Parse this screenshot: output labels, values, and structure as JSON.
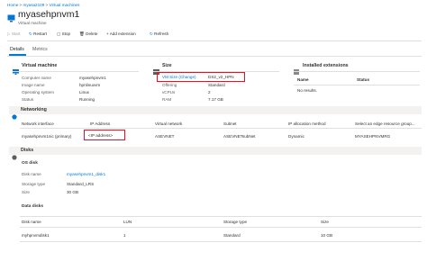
{
  "breadcrumb": [
    "Home",
    "myasa2109",
    "Virtual machines"
  ],
  "breadcrumb_sep": ">",
  "title": "myasehpnvm1",
  "title_more": "...",
  "subtitle": "Virtual machine",
  "toolbar": {
    "start": "Start",
    "restart": "Restart",
    "stop": "Stop",
    "delete": "Delete",
    "add_extension": "Add extension",
    "refresh": "Refresh"
  },
  "tabs": {
    "details": "Details",
    "metrics": "Metrics"
  },
  "vm_section": {
    "title": "Virtual machine",
    "rows": [
      {
        "label": "Computer name",
        "value": "myasehpnvm1"
      },
      {
        "label": "Image name",
        "value": "hpnlinuxvm"
      },
      {
        "label": "Operating system",
        "value": "Linux"
      },
      {
        "label": "Status",
        "value": "Running"
      }
    ]
  },
  "size_section": {
    "title": "Size",
    "vm_size_label": "VM Size (Change)",
    "vm_size_value": "DS2_v2_HPN",
    "rows": [
      {
        "label": "Offering",
        "value": "Standard"
      },
      {
        "label": "vCPUs",
        "value": "2"
      },
      {
        "label": "RAM",
        "value": "7.17 GB"
      }
    ]
  },
  "extensions_section": {
    "title": "Installed extensions",
    "col_name": "Name",
    "col_status": "Status",
    "empty": "No results."
  },
  "networking": {
    "title": "Networking",
    "columns": [
      "Network interface",
      "IP Address",
      "Virtual network",
      "Subnet",
      "IP allocation method",
      "Select an edge resource group..."
    ],
    "row": [
      "myasehpnvm1nic (primary)",
      "<IP address>",
      "ASEVNET",
      "ASEVNETsubNet",
      "Dynamic",
      "MYASEHPNVMRG"
    ]
  },
  "disks": {
    "title": "Disks",
    "os_disk_title": "OS disk",
    "os_rows": [
      {
        "label": "Disk name",
        "value": "myasehpnvm1_disk1"
      },
      {
        "label": "Storage type",
        "value": "Standard_LRS"
      },
      {
        "label": "Size",
        "value": "30 GB"
      }
    ],
    "data_disks_title": "Data disks",
    "columns": [
      "Disk name",
      "LUN",
      "Storage type",
      "Size"
    ],
    "row": [
      "myhpnvmdisk1",
      "1",
      "Standard",
      "10 GB"
    ]
  },
  "colors": {
    "accent": "#0078d4",
    "highlight": "#e81123",
    "section_bg": "#f3f2f1"
  }
}
